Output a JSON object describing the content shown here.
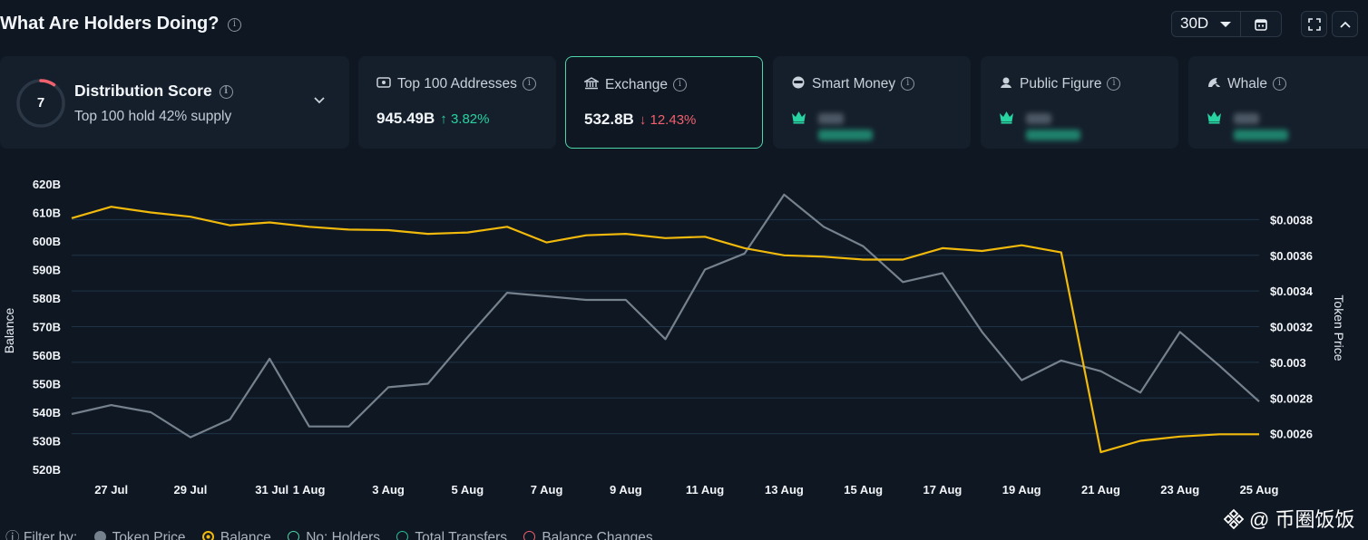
{
  "header": {
    "title": "What Are Holders Doing?",
    "period": "30D"
  },
  "distribution": {
    "score": "7",
    "title": "Distribution Score",
    "subtitle": "Top 100 hold 42% supply"
  },
  "cards": [
    {
      "label": "Top 100 Addresses",
      "icon": "wallet-icon",
      "value": "945.49B",
      "change": "3.82%",
      "direction": "up",
      "blurred": false,
      "active": false
    },
    {
      "label": "Exchange",
      "icon": "bank-icon",
      "value": "532.8B",
      "change": "12.43%",
      "direction": "down",
      "blurred": false,
      "active": true
    },
    {
      "label": "Smart Money",
      "icon": "smart-money-icon",
      "blurred": true,
      "active": false
    },
    {
      "label": "Public Figure",
      "icon": "public-figure-icon",
      "blurred": true,
      "active": false
    },
    {
      "label": "Whale",
      "icon": "whale-icon",
      "blurred": true,
      "active": false
    }
  ],
  "chart_data": {
    "type": "line",
    "x": [
      "26 Jul",
      "27 Jul",
      "28 Jul",
      "29 Jul",
      "30 Jul",
      "31 Jul",
      "1 Aug",
      "2 Aug",
      "3 Aug",
      "4 Aug",
      "5 Aug",
      "6 Aug",
      "7 Aug",
      "8 Aug",
      "9 Aug",
      "10 Aug",
      "11 Aug",
      "12 Aug",
      "13 Aug",
      "14 Aug",
      "15 Aug",
      "16 Aug",
      "17 Aug",
      "18 Aug",
      "19 Aug",
      "20 Aug",
      "21 Aug",
      "22 Aug",
      "23 Aug",
      "24 Aug",
      "25 Aug"
    ],
    "xticks": [
      "27 Jul",
      "29 Jul",
      "31 Jul",
      "1 Aug",
      "3 Aug",
      "5 Aug",
      "7 Aug",
      "9 Aug",
      "11 Aug",
      "13 Aug",
      "15 Aug",
      "17 Aug",
      "19 Aug",
      "21 Aug",
      "23 Aug",
      "25 Aug"
    ],
    "series": [
      {
        "name": "Balance",
        "axis": "left",
        "color": "#f0b90b",
        "values": [
          608,
          612,
          610,
          608.5,
          605.5,
          606.5,
          605,
          604,
          603.8,
          602.5,
          603,
          605,
          599.5,
          602,
          602.5,
          601,
          601.5,
          597.5,
          595,
          594.5,
          593.5,
          593.5,
          597.5,
          596.5,
          598.5,
          596,
          526,
          530,
          531.5,
          532.3,
          532.3
        ]
      },
      {
        "name": "Token Price",
        "axis": "right",
        "color": "#76818e",
        "values": [
          0.00271,
          0.00276,
          0.00272,
          0.00258,
          0.00268,
          0.00302,
          0.00264,
          0.00264,
          0.00286,
          0.00288,
          0.00314,
          0.00339,
          0.00337,
          0.00335,
          0.00335,
          0.00313,
          0.00352,
          0.00361,
          0.00394,
          0.00376,
          0.00365,
          0.00345,
          0.0035,
          0.00317,
          0.0029,
          0.00301,
          0.00295,
          0.00283,
          0.00317,
          0.00298,
          0.00278
        ]
      }
    ],
    "y_left": {
      "label": "Balance",
      "ticks": [
        "520B",
        "530B",
        "540B",
        "550B",
        "560B",
        "570B",
        "580B",
        "590B",
        "600B",
        "610B",
        "620B"
      ],
      "range": [
        520,
        620
      ]
    },
    "y_right": {
      "label": "Token Price",
      "ticks": [
        "$0.0026",
        "$0.0028",
        "$0.003",
        "$0.0032",
        "$0.0034",
        "$0.0036",
        "$0.0038"
      ],
      "range": [
        0.0024,
        0.004
      ]
    },
    "grid": true
  },
  "filter": {
    "label": "Filter by:",
    "items": [
      {
        "label": "Token Price",
        "color": "#76818e",
        "style": "filled"
      },
      {
        "label": "Balance",
        "color": "#f0b90b",
        "style": "selected"
      },
      {
        "label": "No: Holders",
        "color": "#4dd6a8",
        "style": "ring"
      },
      {
        "label": "Total Transfers",
        "color": "#2bbf9a",
        "style": "ring"
      },
      {
        "label": "Balance Changes",
        "color": "#f0616d",
        "style": "ring"
      }
    ]
  },
  "watermark": "@ 币圈饭饭"
}
